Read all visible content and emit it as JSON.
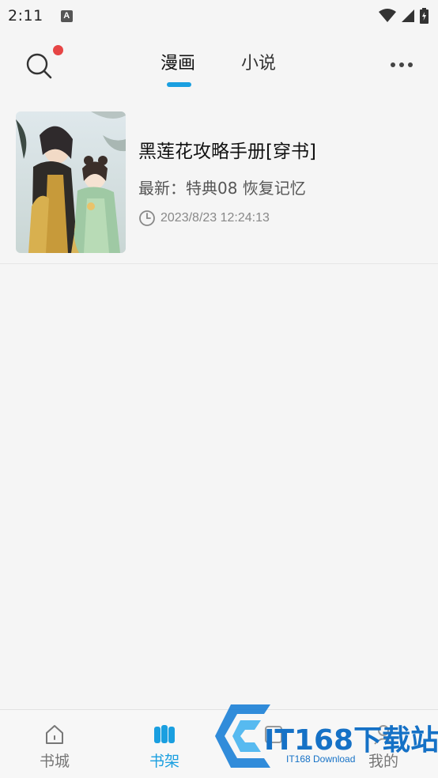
{
  "status_bar": {
    "time": "2:11",
    "notification_icon": "A"
  },
  "header": {
    "tabs": [
      {
        "label": "漫画",
        "active": true
      },
      {
        "label": "小说",
        "active": false
      }
    ],
    "accent_color": "#1a9fe0",
    "badge_color": "#e64545"
  },
  "books": [
    {
      "title": "黑莲花攻略手册[穿书]",
      "latest": "最新：特典08 恢复记忆",
      "updated": "2023/8/23 12:24:13"
    }
  ],
  "bottom_nav": {
    "items": [
      {
        "label": "书城",
        "icon": "home-icon",
        "active": false
      },
      {
        "label": "书架",
        "icon": "bookshelf-icon",
        "active": true
      },
      {
        "label": "",
        "icon": "category-icon",
        "active": false
      },
      {
        "label": "我的",
        "icon": "profile-icon",
        "active": false
      }
    ]
  },
  "watermark": {
    "title": "IT168下载站",
    "subtitle": "IT168 Download"
  }
}
